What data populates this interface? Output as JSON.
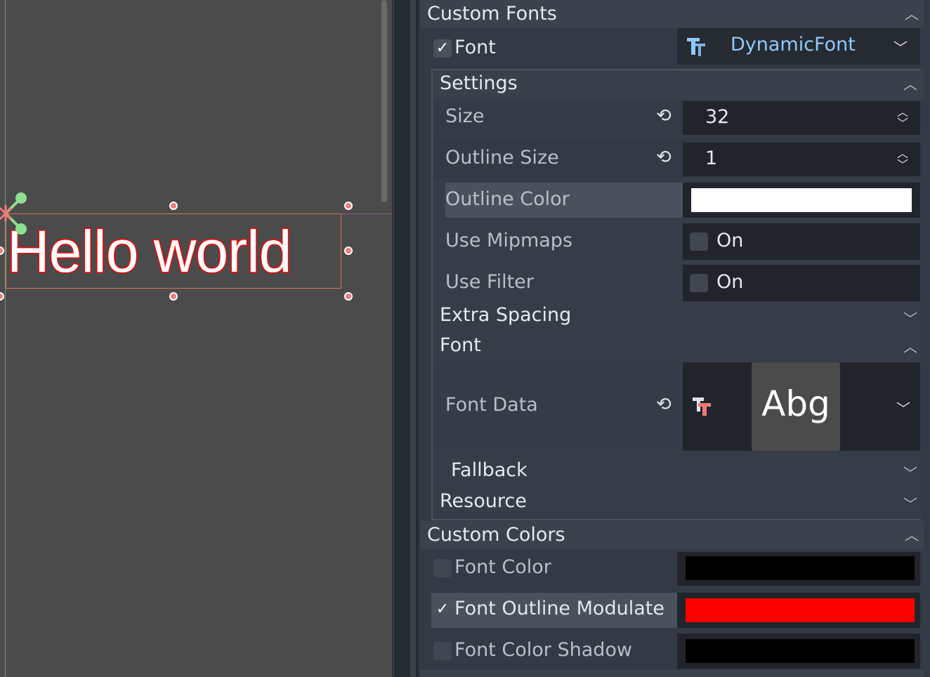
{
  "viewport": {
    "label_text": "Hello world"
  },
  "inspector": {
    "custom_fonts": {
      "title": "Custom Fonts",
      "font": {
        "checked": true,
        "label": "Font",
        "value": "DynamicFont",
        "icon": "dynamic-font-icon"
      },
      "settings": {
        "title": "Settings",
        "size_label": "Size",
        "size_value": "32",
        "outline_size_label": "Outline Size",
        "outline_size_value": "1",
        "outline_color_label": "Outline Color",
        "outline_color": "#ffffff",
        "use_mipmaps_label": "Use Mipmaps",
        "use_mipmaps_value": "On",
        "use_filter_label": "Use Filter",
        "use_filter_value": "On"
      },
      "extra_spacing_label": "Extra Spacing",
      "font_section": {
        "title": "Font",
        "font_data_label": "Font Data",
        "preview_text": "Abg",
        "icon": "font-file-icon"
      },
      "fallback_label": "Fallback",
      "resource_label": "Resource"
    },
    "custom_colors": {
      "title": "Custom Colors",
      "font_color_label": "Font Color",
      "font_color": "#000000",
      "font_outline_modulate_label": "Font Outline Modulate",
      "font_outline_modulate": "#ff0000",
      "font_color_shadow_label": "Font Color Shadow",
      "font_color_shadow": "#000000"
    }
  },
  "colors": {
    "accent_blue": "#8fc9ff",
    "handle": "#f07a7a",
    "pivot_green": "#8ee08e"
  }
}
